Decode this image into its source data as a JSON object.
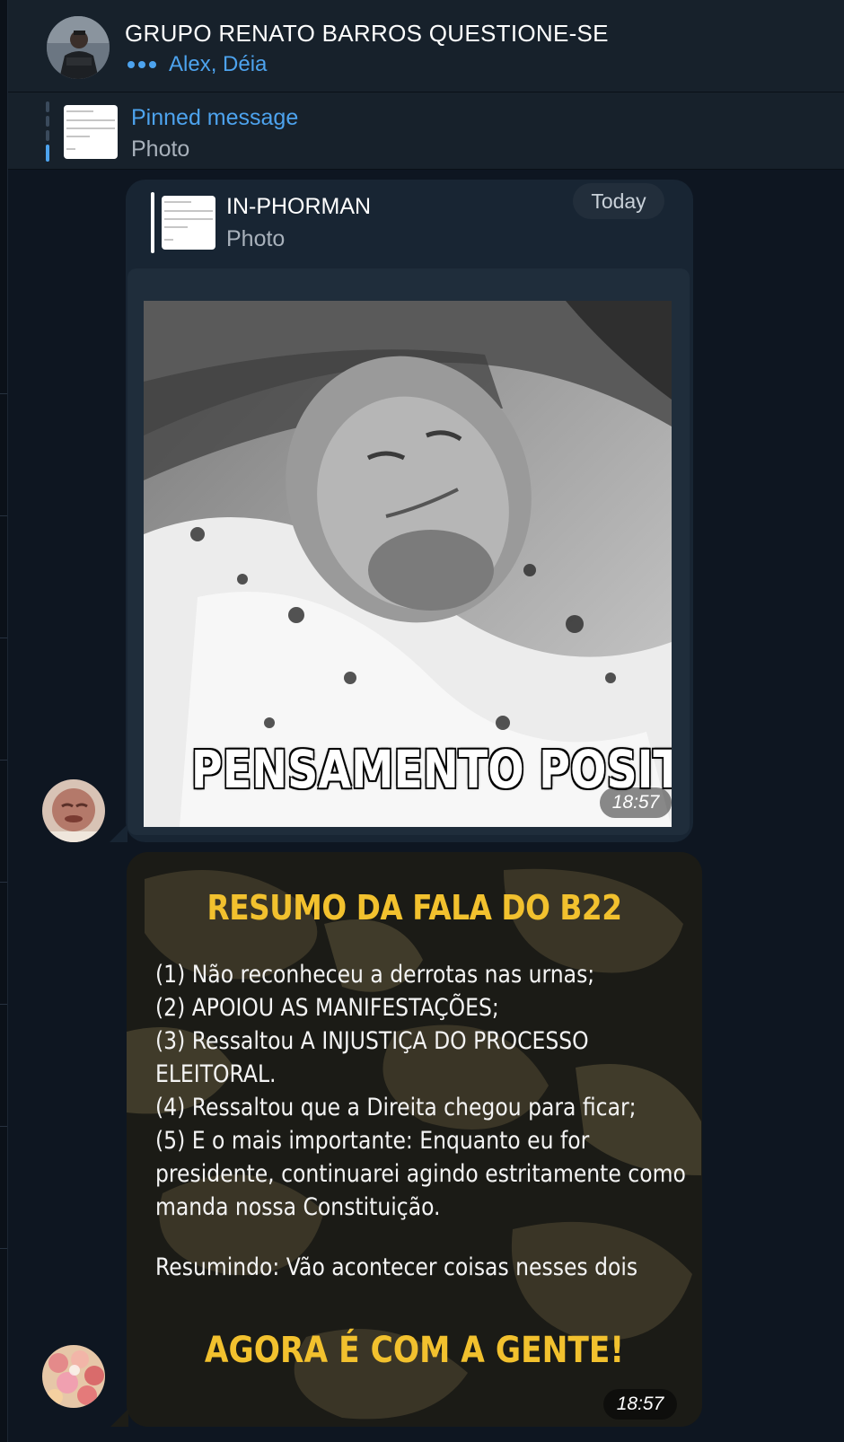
{
  "header": {
    "title": "GRUPO RENATO BARROS QUESTIONE-SE",
    "typing_users": "Alex, Déia"
  },
  "pinned": {
    "label": "Pinned message",
    "subtitle": "Photo"
  },
  "messages": [
    {
      "reply": {
        "author": "IN-PHORMAN",
        "preview": "Photo"
      },
      "date_badge": "Today",
      "image_caption": "PENSAMENTO POSITIVO",
      "time": "18:57"
    },
    {
      "poster": {
        "title": "RESUMO DA FALA DO B22",
        "lines": [
          "(1) Não reconheceu a derrotas nas urnas;",
          "(2) APOIOU AS MANIFESTAÇÕES;",
          "(3) Ressaltou A INJUSTIÇA DO PROCESSO",
          "ELEITORAL.",
          "(4) Ressaltou que a Direita chegou para ficar;",
          "(5) E o mais importante: Enquanto eu for",
          "presidente, continuarei agindo estritamente como",
          "manda nossa Constituição."
        ],
        "summary": "Resumindo: Vão acontecer coisas nesses dois",
        "cta": "AGORA É COM A GENTE!"
      },
      "time": "18:57"
    }
  ],
  "colors": {
    "background": "#0e1621",
    "header": "#17212b",
    "bubble": "#182533",
    "accent": "#4da3ee",
    "poster_yellow": "#f2c12e"
  },
  "icons": [
    "typing-dots-icon"
  ]
}
